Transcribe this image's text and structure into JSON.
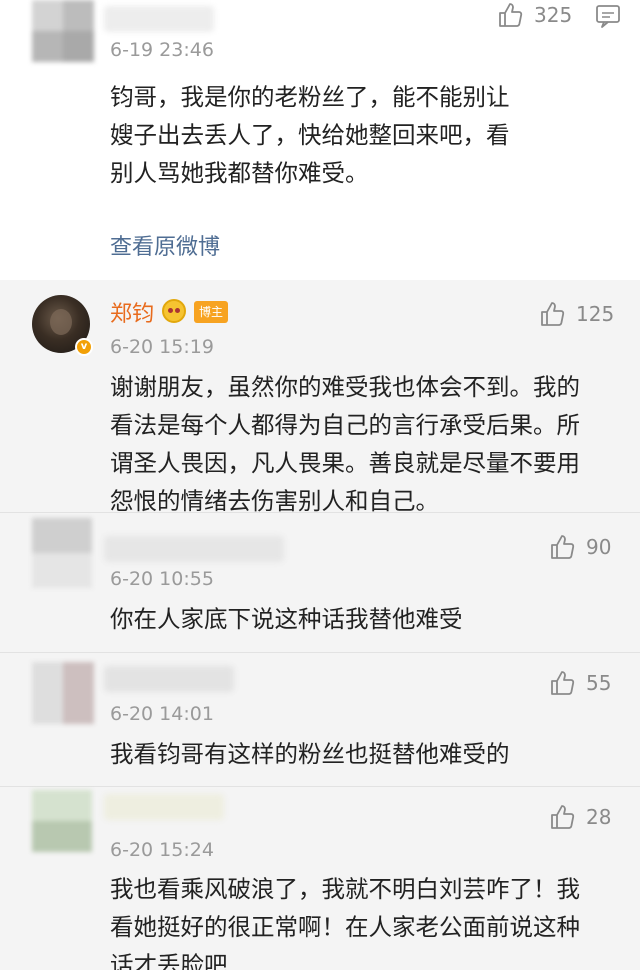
{
  "top_comment": {
    "timestamp": "6-19 23:46",
    "like_count": "325",
    "text_lines": [
      "钧哥，我是你的老粉丝了，能不能别让",
      "嫂子出去丢人了，快给她整回来吧，看",
      "别人骂她我都替你难受。"
    ],
    "view_original_label": "查看原微博"
  },
  "replies": [
    {
      "username": "郑钧",
      "role_badge": "博主",
      "timestamp": "6-20 15:19",
      "like_count": "125",
      "text_lines": [
        "谢谢朋友，虽然你的难受我也体会不到。我的",
        "看法是每个人都得为自己的言行承受后果。所",
        "谓圣人畏因，凡人畏果。善良就是尽量不要用",
        "怨恨的情绪去伤害别人和自己。"
      ]
    },
    {
      "timestamp": "6-20 10:55",
      "like_count": "90",
      "text_lines": [
        "你在人家底下说这种话我替他难受"
      ]
    },
    {
      "timestamp": "6-20 14:01",
      "like_count": "55",
      "text_lines": [
        "我看钧哥有这样的粉丝也挺替他难受的"
      ]
    },
    {
      "timestamp": "6-20 15:24",
      "like_count": "28",
      "text_lines": [
        "我也看乘风破浪了，我就不明白刘芸咋了！我",
        "看她挺好的很正常啊！在人家老公面前说这种",
        "话才丢脸吧"
      ]
    }
  ],
  "colors": {
    "username": "#e86b1d",
    "link": "#4f6d93",
    "timestamp": "#9a9a9a",
    "badge": "#f7a321"
  },
  "icons": {
    "like": "thumbs-up-icon",
    "comment": "comment-bubble-icon",
    "verified": "verified-v-icon"
  }
}
